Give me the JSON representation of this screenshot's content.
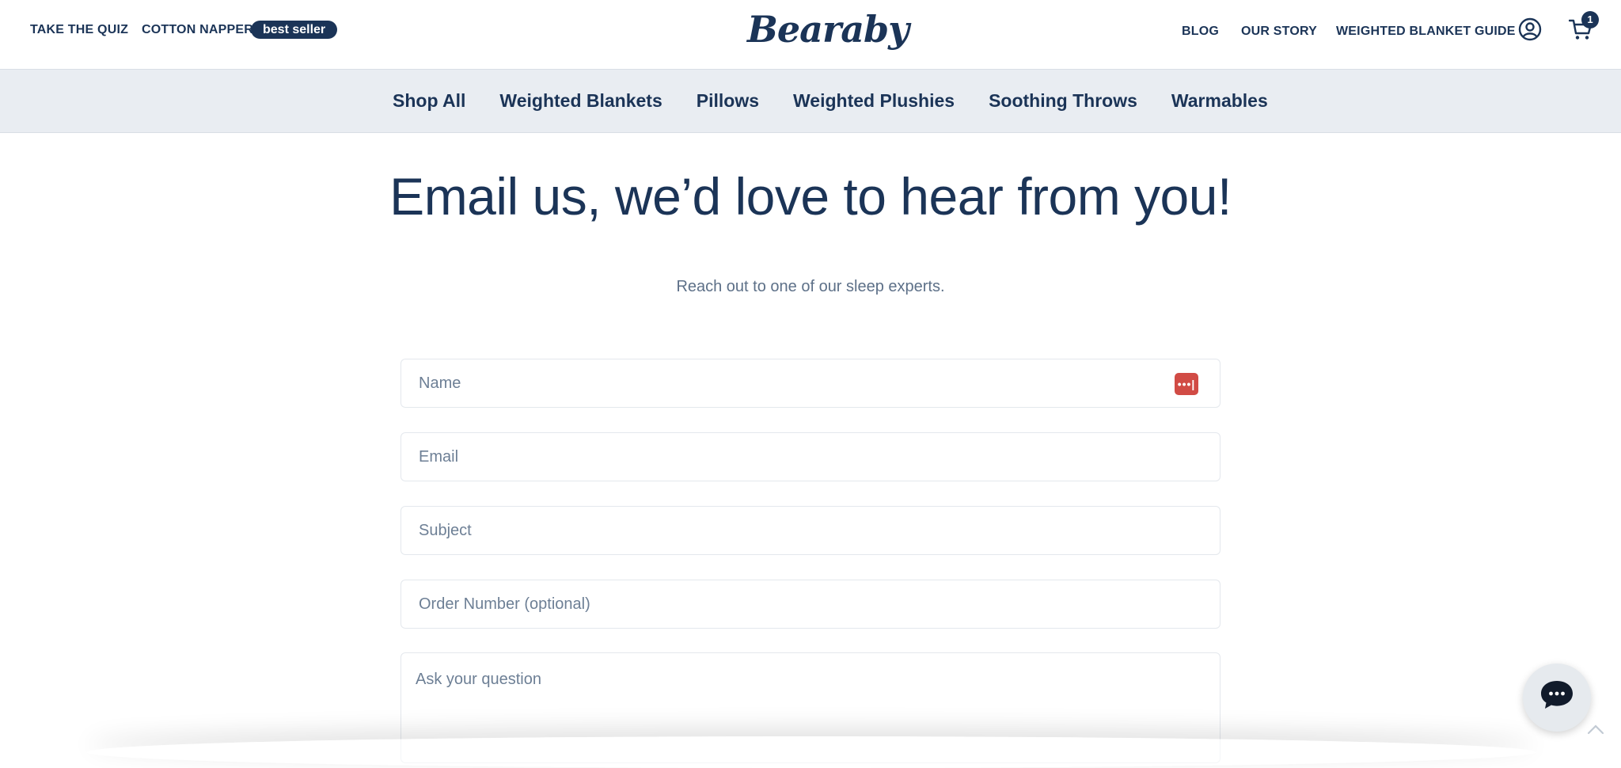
{
  "header": {
    "left_links": [
      "TAKE THE QUIZ",
      "COTTON NAPPER"
    ],
    "badge": "best seller",
    "logo": "Bearaby",
    "right_links": [
      "BLOG",
      "OUR STORY",
      "WEIGHTED BLANKET GUIDE"
    ],
    "cart_count": "1"
  },
  "categories": [
    "Shop All",
    "Weighted Blankets",
    "Pillows",
    "Weighted Plushies",
    "Soothing Throws",
    "Warmables"
  ],
  "main": {
    "title": "Email us, we’d love to hear from you!",
    "subtitle": "Reach out to one of our sleep experts."
  },
  "form": {
    "name_placeholder": "Name",
    "email_placeholder": "Email",
    "subject_placeholder": "Subject",
    "order_placeholder": "Order Number (optional)",
    "question_placeholder": "Ask your question",
    "password_key_glyph": "•••|"
  },
  "colors": {
    "brand_navy": "#1b3457",
    "nav_bg": "#e9edf2",
    "password_key": "#d14b45"
  }
}
